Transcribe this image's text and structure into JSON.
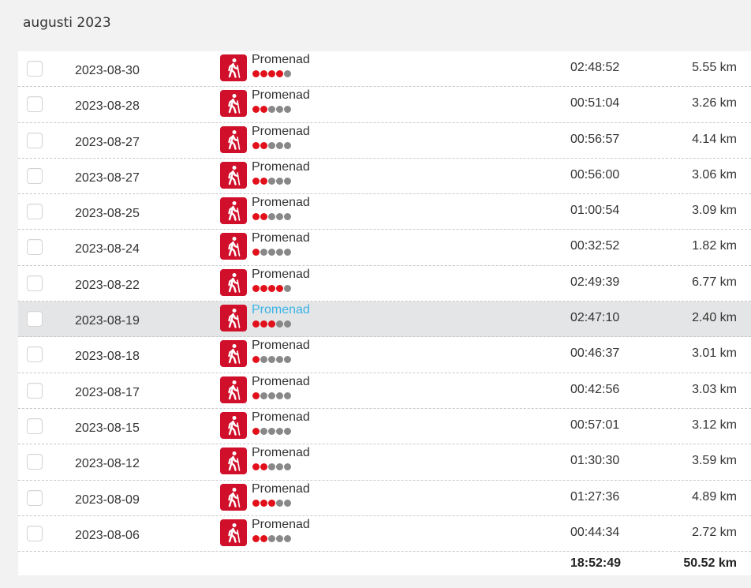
{
  "header": {
    "month_title": "augusti 2023"
  },
  "colors": {
    "accent_red": "#d0102a",
    "dot_on": "#e1101a",
    "dot_off": "#888888",
    "link_hover": "#3ab4e6",
    "row_highlight": "#e4e5e6"
  },
  "activities": [
    {
      "date": "2023-08-30",
      "type": "Promenad",
      "icon": "walking-person-icon",
      "intensity": 4,
      "duration": "02:48:52",
      "distance": "5.55 km"
    },
    {
      "date": "2023-08-28",
      "type": "Promenad",
      "icon": "walking-person-icon",
      "intensity": 2,
      "duration": "00:51:04",
      "distance": "3.26 km"
    },
    {
      "date": "2023-08-27",
      "type": "Promenad",
      "icon": "walking-person-icon",
      "intensity": 2,
      "duration": "00:56:57",
      "distance": "4.14 km"
    },
    {
      "date": "2023-08-27",
      "type": "Promenad",
      "icon": "walking-person-icon",
      "intensity": 2,
      "duration": "00:56:00",
      "distance": "3.06 km"
    },
    {
      "date": "2023-08-25",
      "type": "Promenad",
      "icon": "walking-person-icon",
      "intensity": 2,
      "duration": "01:00:54",
      "distance": "3.09 km"
    },
    {
      "date": "2023-08-24",
      "type": "Promenad",
      "icon": "walking-person-icon",
      "intensity": 1,
      "duration": "00:32:52",
      "distance": "1.82 km"
    },
    {
      "date": "2023-08-22",
      "type": "Promenad",
      "icon": "walking-person-icon",
      "intensity": 4,
      "duration": "02:49:39",
      "distance": "6.77 km"
    },
    {
      "date": "2023-08-19",
      "type": "Promenad",
      "icon": "walking-person-icon",
      "intensity": 3,
      "duration": "02:47:10",
      "distance": "2.40 km",
      "highlighted": true
    },
    {
      "date": "2023-08-18",
      "type": "Promenad",
      "icon": "walking-person-icon",
      "intensity": 1,
      "duration": "00:46:37",
      "distance": "3.01 km"
    },
    {
      "date": "2023-08-17",
      "type": "Promenad",
      "icon": "walking-person-icon",
      "intensity": 1,
      "duration": "00:42:56",
      "distance": "3.03 km"
    },
    {
      "date": "2023-08-15",
      "type": "Promenad",
      "icon": "walking-person-icon",
      "intensity": 1,
      "duration": "00:57:01",
      "distance": "3.12 km"
    },
    {
      "date": "2023-08-12",
      "type": "Promenad",
      "icon": "walking-person-icon",
      "intensity": 2,
      "duration": "01:30:30",
      "distance": "3.59 km"
    },
    {
      "date": "2023-08-09",
      "type": "Promenad",
      "icon": "walking-person-icon",
      "intensity": 3,
      "duration": "01:27:36",
      "distance": "4.89 km"
    },
    {
      "date": "2023-08-06",
      "type": "Promenad",
      "icon": "walking-person-icon",
      "intensity": 2,
      "duration": "00:44:34",
      "distance": "2.72 km"
    }
  ],
  "intensity_max": 5,
  "totals": {
    "duration": "18:52:49",
    "distance": "50.52 km"
  }
}
